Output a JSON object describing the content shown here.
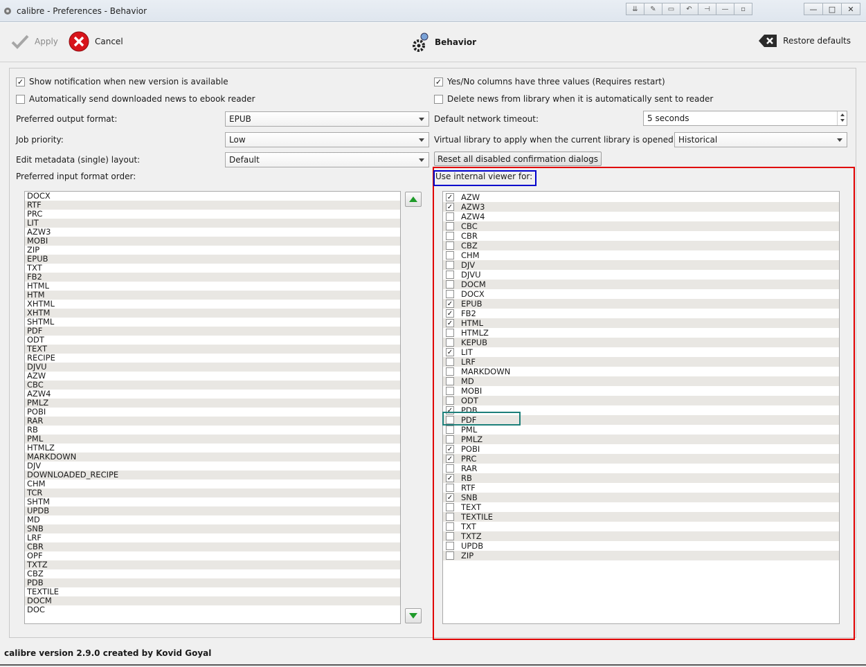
{
  "window": {
    "title": "calibre - Preferences - Behavior",
    "title_buttons": [
      "⇊",
      "✎",
      "▭",
      "↶",
      "⊣",
      "—",
      "▫"
    ],
    "controls": [
      "—",
      "□",
      "✕"
    ]
  },
  "toolbar": {
    "apply_label": "Apply",
    "cancel_label": "Cancel",
    "section_title": "Behavior",
    "restore_label": "Restore defaults"
  },
  "left": {
    "show_notification": {
      "label": "Show notification when new version is available",
      "checked": true
    },
    "auto_send_news": {
      "label": "Automatically send downloaded news to ebook reader",
      "checked": false
    },
    "output_format_label": "Preferred output format:",
    "output_format_value": "EPUB",
    "job_priority_label": "Job priority:",
    "job_priority_value": "Low",
    "edit_metadata_label": "Edit metadata (single) layout:",
    "edit_metadata_value": "Default",
    "input_order_label": "Preferred input format order:",
    "input_formats": [
      "DOCX",
      "RTF",
      "PRC",
      "LIT",
      "AZW3",
      "MOBI",
      "ZIP",
      "EPUB",
      "TXT",
      "FB2",
      "HTML",
      "HTM",
      "XHTML",
      "XHTM",
      "SHTML",
      "PDF",
      "ODT",
      "TEXT",
      "RECIPE",
      "DJVU",
      "AZW",
      "CBC",
      "AZW4",
      "PMLZ",
      "POBI",
      "RAR",
      "RB",
      "PML",
      "HTMLZ",
      "MARKDOWN",
      "DJV",
      "DOWNLOADED_RECIPE",
      "CHM",
      "TCR",
      "SHTM",
      "UPDB",
      "MD",
      "SNB",
      "LRF",
      "CBR",
      "OPF",
      "TXTZ",
      "CBZ",
      "PDB",
      "TEXTILE",
      "DOCM",
      "DOC"
    ]
  },
  "right": {
    "yes_no_columns": {
      "label": "Yes/No columns have three values (Requires restart)",
      "checked": true
    },
    "delete_news": {
      "label": "Delete news from library when it is automatically sent to reader",
      "checked": false
    },
    "network_timeout_label": "Default network timeout:",
    "network_timeout_value": "5 seconds",
    "virtual_library_label": "Virtual library to apply when the current library is opened:",
    "virtual_library_value": "Historical",
    "reset_dialogs_label": "Reset all disabled confirmation dialogs",
    "viewer_label": "Use internal viewer for:",
    "viewer_formats": [
      {
        "name": "AZW",
        "checked": true
      },
      {
        "name": "AZW3",
        "checked": true
      },
      {
        "name": "AZW4",
        "checked": false
      },
      {
        "name": "CBC",
        "checked": false
      },
      {
        "name": "CBR",
        "checked": false
      },
      {
        "name": "CBZ",
        "checked": false
      },
      {
        "name": "CHM",
        "checked": false
      },
      {
        "name": "DJV",
        "checked": false
      },
      {
        "name": "DJVU",
        "checked": false
      },
      {
        "name": "DOCM",
        "checked": false
      },
      {
        "name": "DOCX",
        "checked": false
      },
      {
        "name": "EPUB",
        "checked": true
      },
      {
        "name": "FB2",
        "checked": true
      },
      {
        "name": "HTML",
        "checked": true
      },
      {
        "name": "HTMLZ",
        "checked": false
      },
      {
        "name": "KEPUB",
        "checked": false
      },
      {
        "name": "LIT",
        "checked": true
      },
      {
        "name": "LRF",
        "checked": false
      },
      {
        "name": "MARKDOWN",
        "checked": false
      },
      {
        "name": "MD",
        "checked": false
      },
      {
        "name": "MOBI",
        "checked": false
      },
      {
        "name": "ODT",
        "checked": false
      },
      {
        "name": "PDB",
        "checked": true
      },
      {
        "name": "PDF",
        "checked": false
      },
      {
        "name": "PML",
        "checked": false
      },
      {
        "name": "PMLZ",
        "checked": false
      },
      {
        "name": "POBI",
        "checked": true
      },
      {
        "name": "PRC",
        "checked": true
      },
      {
        "name": "RAR",
        "checked": false
      },
      {
        "name": "RB",
        "checked": true
      },
      {
        "name": "RTF",
        "checked": false
      },
      {
        "name": "SNB",
        "checked": true
      },
      {
        "name": "TEXT",
        "checked": false
      },
      {
        "name": "TEXTILE",
        "checked": false
      },
      {
        "name": "TXT",
        "checked": false
      },
      {
        "name": "TXTZ",
        "checked": false
      },
      {
        "name": "UPDB",
        "checked": false
      },
      {
        "name": "ZIP",
        "checked": false
      }
    ]
  },
  "status": {
    "text": "calibre version 2.9.0 created by Kovid Goyal"
  },
  "colors": {
    "highlight_red": "#e00000",
    "highlight_blue": "#0000cc",
    "highlight_teal": "#1c7f7a",
    "arrow_green": "#1f9b2a"
  }
}
